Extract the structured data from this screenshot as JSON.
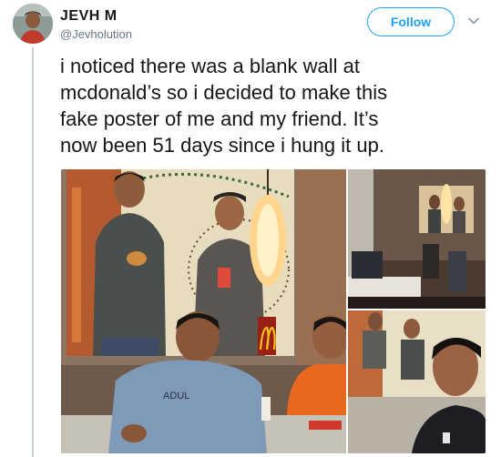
{
  "user": {
    "display_name": "JEVH M",
    "handle": "@Jevholution"
  },
  "actions": {
    "follow_label": "Follow",
    "more_icon": "chevron-down-icon"
  },
  "tweet": {
    "text": "i noticed there was a blank wall at\nmcdonald’s so i decided to make this\nfake poster of me and my friend. It’s\nnow been 51 days since i hung it up."
  },
  "media": {
    "photo_count": 3,
    "shirt_print": "ADUL"
  },
  "colors": {
    "accent": "#1da1f2",
    "text": "#14171a",
    "secondary": "#657786",
    "rail": "#c6d1d9",
    "mcdonalds_yellow": "#f2c21b"
  }
}
